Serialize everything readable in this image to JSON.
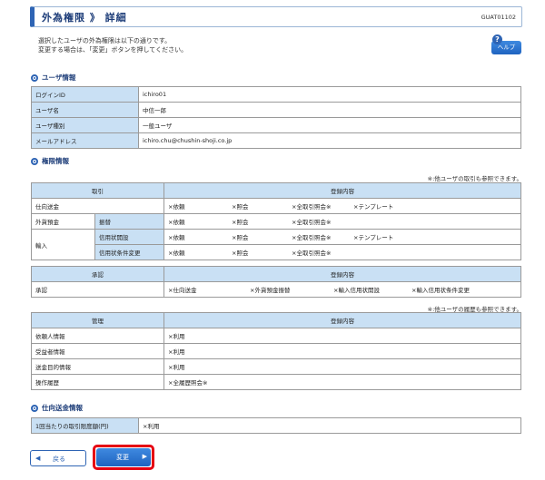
{
  "header": {
    "title": "外為権限 》 詳細",
    "screen_id": "GUAT01102"
  },
  "intro": {
    "line1": "選択したユーザの外為権限は以下の通りです。",
    "line2": "変更する場合は、「変更」ボタンを押してください。"
  },
  "help": {
    "icon": "?",
    "label": "ヘルプ"
  },
  "user_info": {
    "heading": "ユーザ情報",
    "rows": [
      {
        "label": "ログインID",
        "value": "ichiro01"
      },
      {
        "label": "ユーザ名",
        "value": "中信一郎"
      },
      {
        "label": "ユーザ種別",
        "value": "一般ユーザ"
      },
      {
        "label": "メールアドレス",
        "value": "ichiro.chu@chushin-shoji.co.jp"
      }
    ]
  },
  "auth_info": {
    "heading": "権限情報",
    "note1": "※:他ユーザの取引も参照できます。",
    "transactions": {
      "col1": "取引",
      "col2": "登録内容",
      "rows": {
        "remit": {
          "label": "仕向送金",
          "opts": [
            "×依頼",
            "×照会",
            "×全取引照会※",
            "×テンプレート"
          ]
        },
        "fx_deposit": {
          "label": "外貨預金",
          "sub": "振替",
          "opts": [
            "×依頼",
            "×照会",
            "×全取引照会※"
          ]
        },
        "import": {
          "label": "輸入"
        },
        "lc_open": {
          "sub": "信用状開設",
          "opts": [
            "×依頼",
            "×照会",
            "×全取引照会※",
            "×テンプレート"
          ]
        },
        "lc_change": {
          "sub": "信用状条件変更",
          "opts": [
            "×依頼",
            "×照会",
            "×全取引照会※"
          ]
        }
      }
    },
    "approval": {
      "col1": "承認",
      "col2": "登録内容",
      "label": "承認",
      "opts": [
        "×仕向送金",
        "×外貨預金振替",
        "×輸入信用状開設",
        "×輸入信用状条件変更"
      ]
    },
    "note2": "※:他ユーザの履歴も参照できます。",
    "management": {
      "col1": "管理",
      "col2": "登録内容",
      "rows": [
        {
          "label": "依頼人情報",
          "value": "×利用"
        },
        {
          "label": "受益者情報",
          "value": "×利用"
        },
        {
          "label": "送金目的情報",
          "value": "×利用"
        },
        {
          "label": "操作履歴",
          "value": "×全履歴照会※"
        }
      ]
    }
  },
  "remit_info": {
    "heading": "仕向送金情報",
    "label": "1回当たりの取引限度額(円)",
    "value": "×利用"
  },
  "buttons": {
    "back": "戻る",
    "back_icon": "◀",
    "change": "変更",
    "change_icon": "▶"
  }
}
